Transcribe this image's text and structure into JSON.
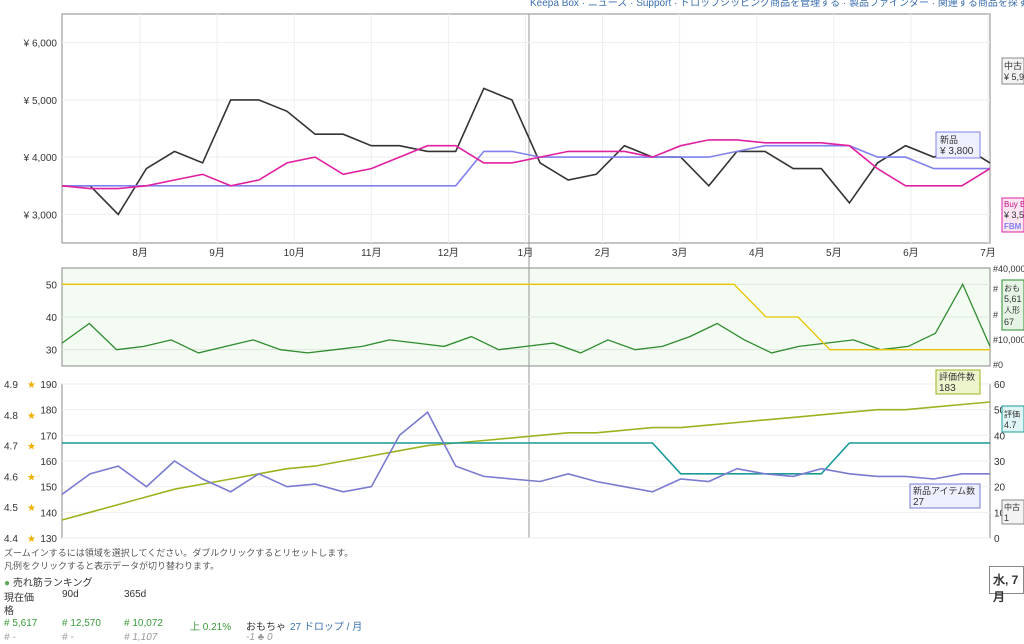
{
  "top_links": "Keepa Box · ニュース · Support · ドロップシッピング商品を管理する · 製品ファインダー · 関連する商品を探す",
  "chart_data": [
    {
      "type": "line",
      "title": "price",
      "x_ticks": [
        "8月",
        "9月",
        "10月",
        "11月",
        "12月",
        "1月",
        "2月",
        "3月",
        "4月",
        "5月",
        "6月",
        "7月"
      ],
      "y_ticks": [
        "¥ 3,000",
        "¥ 4,000",
        "¥ 5,000",
        "¥ 6,000"
      ],
      "ylim": [
        2500,
        6500
      ],
      "series": [
        {
          "name": "中古",
          "color": "#333333",
          "values": [
            3500,
            3500,
            3000,
            3800,
            4100,
            3900,
            5000,
            5000,
            4800,
            4400,
            4400,
            4200,
            4200,
            4100,
            4100,
            5200,
            5000,
            3900,
            3600,
            3700,
            4200,
            4000,
            4000,
            3500,
            4100,
            4100,
            3800,
            3800,
            3200,
            3900,
            4200,
            4000,
            4200,
            3900
          ]
        },
        {
          "name": "新品",
          "color": "#8080ee",
          "values": [
            3500,
            3500,
            3500,
            3500,
            3500,
            3500,
            3500,
            3500,
            3500,
            3500,
            3500,
            3500,
            3500,
            3500,
            3500,
            4100,
            4100,
            4000,
            4000,
            4000,
            4000,
            4000,
            4000,
            4000,
            4100,
            4200,
            4200,
            4200,
            4200,
            4000,
            4000,
            3800,
            3800,
            3800
          ]
        },
        {
          "name": "Buy Box",
          "color": "#e020a0",
          "values": [
            3500,
            3450,
            3450,
            3500,
            3600,
            3700,
            3500,
            3600,
            3900,
            4000,
            3700,
            3800,
            4000,
            4200,
            4200,
            3900,
            3900,
            4000,
            4100,
            4100,
            4100,
            4000,
            4200,
            4300,
            4300,
            4250,
            4250,
            4250,
            4200,
            3800,
            3500,
            3500,
            3500,
            3800
          ]
        }
      ],
      "labels": [
        {
          "name": "中古",
          "value": "¥ 5,9"
        },
        {
          "name": "新品",
          "value": "¥ 3,800"
        },
        {
          "name": "Buy B",
          "value": "¥ 3,5",
          "extra": "FBM"
        }
      ]
    },
    {
      "type": "line",
      "title": "rank",
      "y_ticks_left": [
        "30",
        "40",
        "50"
      ],
      "y_ticks_right": [
        "#40,000",
        "#",
        "#",
        "#10,000",
        "#0"
      ],
      "ylim": [
        25,
        55
      ],
      "series": [
        {
          "name": "おもちゃ",
          "color": "#2e8b2e",
          "values": [
            32,
            38,
            30,
            31,
            33,
            29,
            31,
            33,
            30,
            29,
            30,
            31,
            33,
            32,
            31,
            34,
            30,
            31,
            32,
            29,
            33,
            30,
            31,
            34,
            38,
            33,
            29,
            31,
            32,
            33,
            30,
            31,
            35,
            50,
            31
          ]
        },
        {
          "name": "人形",
          "color": "#e8c400",
          "values": [
            50,
            50,
            50,
            50,
            50,
            50,
            50,
            50,
            50,
            50,
            50,
            50,
            50,
            50,
            50,
            50,
            50,
            50,
            50,
            50,
            50,
            50,
            40,
            40,
            30,
            30,
            30,
            30,
            30,
            30
          ]
        }
      ],
      "labels": [
        {
          "name": "おも",
          "value": "5,61"
        },
        {
          "name": "人形",
          "value": "67"
        }
      ]
    },
    {
      "type": "line",
      "title": "rating",
      "y_ticks_left": [
        "4.4",
        "4.5",
        "4.6",
        "4.7",
        "4.8",
        "4.9"
      ],
      "y_ticks_mid": [
        "130",
        "140",
        "150",
        "160",
        "170",
        "180",
        "190"
      ],
      "y_ticks_right": [
        "0",
        "10",
        "20",
        "30",
        "40",
        "50",
        "60"
      ],
      "ylim": [
        130,
        190
      ],
      "series": [
        {
          "name": "評価件数",
          "color": "#9ab420",
          "values": [
            137,
            140,
            143,
            146,
            149,
            151,
            153,
            155,
            157,
            158,
            160,
            162,
            164,
            166,
            167,
            168,
            169,
            170,
            171,
            171,
            172,
            173,
            173,
            174,
            175,
            176,
            177,
            178,
            179,
            180,
            180,
            181,
            182,
            183
          ]
        },
        {
          "name": "評価",
          "color": "#1a9a9a",
          "values": [
            167,
            167,
            167,
            167,
            167,
            167,
            167,
            167,
            167,
            167,
            167,
            167,
            167,
            167,
            167,
            167,
            167,
            167,
            167,
            167,
            167,
            167,
            155,
            155,
            155,
            155,
            155,
            155,
            167,
            167,
            167,
            167,
            167,
            167
          ]
        },
        {
          "name": "新品アイテム数",
          "color": "#7a7ad0",
          "values": [
            147,
            155,
            158,
            150,
            160,
            153,
            148,
            155,
            150,
            151,
            148,
            150,
            170,
            179,
            158,
            154,
            153,
            152,
            155,
            152,
            150,
            148,
            153,
            152,
            157,
            155,
            154,
            157,
            155,
            154,
            154,
            153,
            155,
            155
          ]
        }
      ],
      "labels": [
        {
          "name": "評価件数",
          "value": "183"
        },
        {
          "name": "評価",
          "value": "4.7"
        },
        {
          "name": "新品アイテム数",
          "value": "27"
        },
        {
          "name": "中古",
          "value": "1"
        }
      ]
    }
  ],
  "footer": {
    "hint1": "ズームインするには領域を選択してください。ダブルクリックするとリセットします。",
    "hint2": "凡例をクリックすると表示データが切り替わります。",
    "section_title": "売れ筋ランキング",
    "col_current": "現在価",
    "col_current2": "格",
    "col_90d": "90d",
    "col_365d": "365d",
    "row1": [
      "# 5,617",
      "# 12,570",
      "# 10,072",
      "上 0.21%"
    ],
    "row1_cat": "おもちゃ",
    "row1_drop": "27 ドロップ / 月",
    "row2": [
      "#  -",
      "#  -",
      "# 1,107"
    ],
    "row2_extra": "-1 ♣ 0",
    "date_box": "水, 7月"
  }
}
